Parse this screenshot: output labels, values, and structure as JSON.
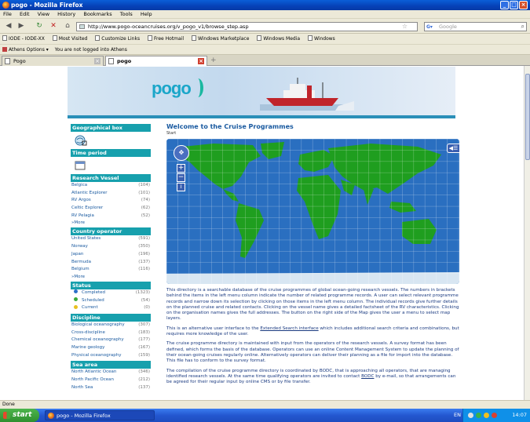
{
  "window": {
    "title": "pogo - Mozilla Firefox"
  },
  "menu": [
    "File",
    "Edit",
    "View",
    "History",
    "Bookmarks",
    "Tools",
    "Help"
  ],
  "nav": {
    "url": "http://www.pogo-oceancruises.org/v_pogo_v1/browse_step.asp",
    "search_placeholder": "Google"
  },
  "bookmarks": [
    "IODE - IODE-XX",
    "Most Visited",
    "Customize Links",
    "Free Hotmail",
    "Windows Marketplace",
    "Windows Media",
    "Windows"
  ],
  "addons": {
    "athens": "Athens Options",
    "status": "You are not logged into Athens"
  },
  "tabs": [
    {
      "label": "Pogo"
    },
    {
      "label": "pogo"
    }
  ],
  "sidebar": {
    "geo_title": "Geographical box",
    "time_title": "Time period",
    "vessel_title": "Research Vessel",
    "vessels": [
      {
        "name": "Belgica",
        "count": "(104)"
      },
      {
        "name": "Atlantic Explorer",
        "count": "(101)"
      },
      {
        "name": "RV Argos",
        "count": "(74)"
      },
      {
        "name": "Celtic Explorer",
        "count": "(62)"
      },
      {
        "name": "RV Pelagia",
        "count": "(52)"
      }
    ],
    "more": "More",
    "country_title": "Country operator",
    "countries": [
      {
        "name": "United States",
        "count": "(591)"
      },
      {
        "name": "Norway",
        "count": "(350)"
      },
      {
        "name": "Japan",
        "count": "(196)"
      },
      {
        "name": "Bermuda",
        "count": "(137)"
      },
      {
        "name": "Belgium",
        "count": "(116)"
      }
    ],
    "status_title": "Status",
    "statuses": [
      {
        "name": "Completed",
        "count": "(1323)",
        "color": "#2a6fc8"
      },
      {
        "name": "Scheduled",
        "count": "(54)",
        "color": "#3aaa3a"
      },
      {
        "name": "Current",
        "count": "(0)",
        "color": "#e8c020"
      }
    ],
    "discipline_title": "Discipline",
    "disciplines": [
      {
        "name": "Biological oceanography",
        "count": "(307)"
      },
      {
        "name": "Cross-discipline",
        "count": "(183)"
      },
      {
        "name": "Chemical oceanography",
        "count": "(177)"
      },
      {
        "name": "Marine geology",
        "count": "(167)"
      },
      {
        "name": "Physical oceanography",
        "count": "(159)"
      }
    ],
    "sea_title": "Sea area",
    "seas": [
      {
        "name": "North Atlantic Ocean",
        "count": "(346)"
      },
      {
        "name": "North Pacific Ocean",
        "count": "(212)"
      },
      {
        "name": "North Sea",
        "count": "(137)"
      }
    ]
  },
  "main": {
    "title": "Welcome to the Cruise Programmes",
    "breadcrumb": "Start",
    "p1": "This directory is a searchable database of the cruise programmes of global ocean-going research vessels. The numbers in brackets behind the items in the left menu column indicate the number of related programme records. A user can select relevant programme records and narrow down its selection by clicking on those items in the left menu column. The individual records give further details on the planned cruise and related contacts. Clicking on the vessel name gives a detailed factsheet of the RV characteristics. Clicking on the organisation names gives the full addresses. The button on the right side of the Map gives the user a menu to select map layers.",
    "p2_before": "This is an alternative user interface to the ",
    "p2_link": "Extended Search interface",
    "p2_after": " which includes additional search criteria and combinations, but requires more knowledge of the user.",
    "p3": "The cruise programme directory is maintained with input from the operators of the research vessels. A survey format has been defined, which forms the basis of the database. Operators can use an online Content Management System to update the planning of their ocean-going cruises regularly online. Alternatively operators can deliver their planning as a file for import into the database. This file has to conform to the survey format.",
    "p4_before": "The compilation of the cruise programme directory is coordinated by BODC, that is approaching all operators, that are managing identified research vessels. At the same time qualifying operators are invited to contact ",
    "p4_link": "BODC",
    "p4_after": " by e-mail, so that arrangements can be agreed for their regular input by online CMS or by file transfer."
  },
  "statusbar": {
    "text": "Done"
  },
  "taskbar": {
    "start": "start",
    "item": "pogo - Mozilla Firefox",
    "lang": "EN",
    "clock": "14:07"
  },
  "colors": {
    "section": "#17a0ad",
    "link": "#1a5aa0",
    "ocean": "#2a6fc0",
    "land": "#1f9e1f"
  }
}
